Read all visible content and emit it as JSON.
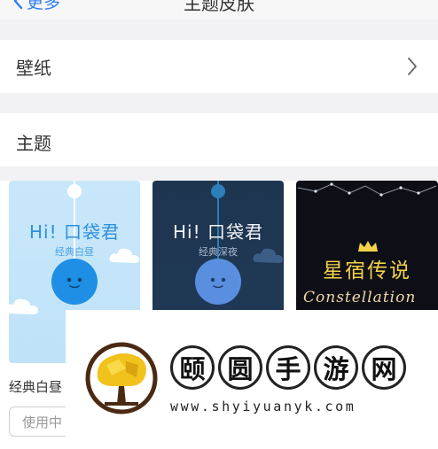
{
  "nav": {
    "back_label": "更多",
    "title": "主题皮肤"
  },
  "wallpaper": {
    "label": "壁纸"
  },
  "themes": {
    "header": "主题",
    "cards": [
      {
        "hi": "Hi! 口袋君",
        "sub": "经典白昼"
      },
      {
        "hi": "Hi! 口袋君",
        "sub": "经典深夜"
      },
      {
        "title": "星宿传说",
        "script": "Constellation"
      }
    ],
    "first_label": "经典白昼",
    "use_button": "使用中"
  },
  "watermark": {
    "chars": [
      "颐",
      "圆",
      "手",
      "游",
      "网"
    ],
    "url": "www.shyiyuanyk.com"
  }
}
